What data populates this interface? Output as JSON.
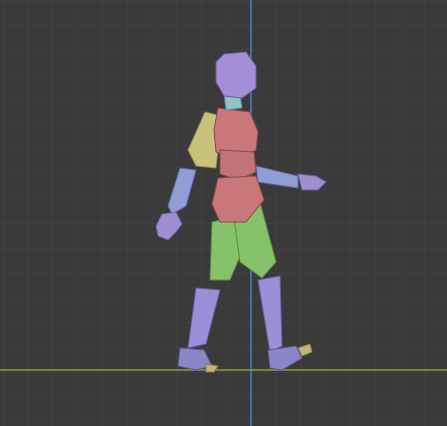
{
  "viewport": {
    "name": "3d-viewport",
    "background": "#3a3a3a",
    "grid_color": "#454545",
    "grid_minor_color": "#404040",
    "axis_vertical_color": "#4b7fc2",
    "axis_horizontal_color": "#7fa33a"
  },
  "figure": {
    "name": "mannequin-walking-side-view",
    "colors": {
      "head": "#a48fd6",
      "neck": "#8fc4c4",
      "torso": "#c9777a",
      "upper_arm_left": "#c8c27a",
      "forearm": "#8f9fd6",
      "hand": "#9f8fd2",
      "thigh": "#86c26a",
      "shin": "#9a90d8",
      "foot": "#8a86c8",
      "toe": "#c8b47a"
    }
  }
}
